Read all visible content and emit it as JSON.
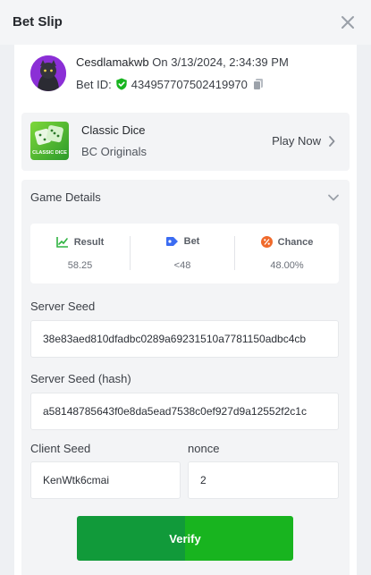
{
  "header": {
    "title": "Bet Slip",
    "close_icon": "close-icon"
  },
  "bet": {
    "username": "Cesdlamakwb",
    "on_text": "On 3/13/2024, 2:34:39 PM",
    "bet_id_label": "Bet ID:",
    "bet_id": "434957707502419970"
  },
  "game": {
    "name": "Classic Dice",
    "provider": "BC Originals",
    "thumb_text": "CLASSIC DICE",
    "play_label": "Play Now"
  },
  "details": {
    "title": "Game Details",
    "stats": [
      {
        "label": "Result",
        "value": "58.25",
        "icon": "result-chart-icon",
        "color": "#2fb341"
      },
      {
        "label": "Bet",
        "value": "<48",
        "icon": "bet-tag-icon",
        "color": "#3b6cf2"
      },
      {
        "label": "Chance",
        "value": "48.00%",
        "icon": "chance-percent-icon",
        "color": "#f06a2b"
      }
    ],
    "server_seed_label": "Server Seed",
    "server_seed": "38e83aed810dfadbc0289a69231510a7781150adbc4cb",
    "server_seed_hash_label": "Server Seed (hash)",
    "server_seed_hash": "a58148785643f0e8da5ead7538c0ef927d9a12552f2c1c",
    "client_seed_label": "Client Seed",
    "client_seed": "KenWtk6cmai",
    "nonce_label": "nonce",
    "nonce": "2"
  },
  "verify_label": "Verify",
  "colors": {
    "accent_green": "#18b41f",
    "check_green": "#18b41f"
  }
}
